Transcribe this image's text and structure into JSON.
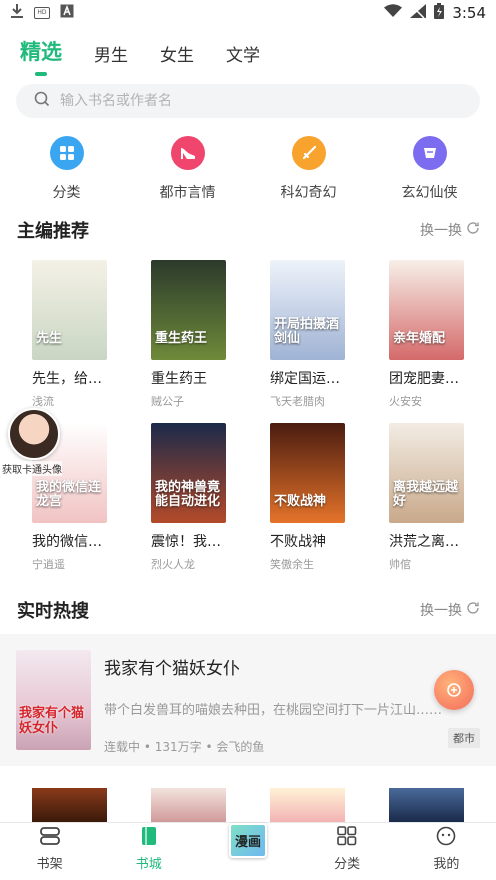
{
  "status_bar": {
    "time": "3:54",
    "left_icons": [
      "download-icon",
      "hd-icon",
      "a-icon"
    ],
    "right_icons": [
      "wifi-icon",
      "signal-icon",
      "battery-icon"
    ]
  },
  "top_tabs": [
    {
      "label": "精选",
      "active": true
    },
    {
      "label": "男生",
      "active": false
    },
    {
      "label": "女生",
      "active": false
    },
    {
      "label": "文学",
      "active": false
    }
  ],
  "search": {
    "placeholder": "输入书名或作者名"
  },
  "categories": [
    {
      "label": "分类",
      "icon": "grid-icon",
      "color": "#3aa6f2"
    },
    {
      "label": "都市言情",
      "icon": "heel-icon",
      "color": "#f0466e"
    },
    {
      "label": "科幻奇幻",
      "icon": "sword-icon",
      "color": "#f7a32e"
    },
    {
      "label": "玄幻仙侠",
      "icon": "scroll-icon",
      "color": "#7b6cf0"
    }
  ],
  "editor_picks": {
    "title": "主编推荐",
    "refresh_label": "换一换",
    "books": [
      {
        "title": "先生，给…",
        "author": "浅流",
        "cover_colors": [
          "#f4f1e6",
          "#c9d6c3"
        ],
        "cover_text": "先生"
      },
      {
        "title": "重生药王",
        "author": "贼公子",
        "cover_colors": [
          "#2b3a2b",
          "#6f8a3a"
        ],
        "cover_text": "重生药王"
      },
      {
        "title": "绑定国运…",
        "author": "飞天老腊肉",
        "cover_colors": [
          "#eef3fa",
          "#9fb3d4"
        ],
        "cover_text": "开局拍摄酒剑仙"
      },
      {
        "title": "团宠肥妻…",
        "author": "火安安",
        "cover_colors": [
          "#f7efe8",
          "#d46a6a"
        ],
        "cover_text": "亲年婚配"
      },
      {
        "title": "我的微信…",
        "author": "宁逍遥",
        "cover_colors": [
          "#ffffff",
          "#f1c3c3"
        ],
        "cover_text": "我的微信连龙宫"
      },
      {
        "title": "震惊！我…",
        "author": "烈火人龙",
        "cover_colors": [
          "#1b2a4a",
          "#b44a2a"
        ],
        "cover_text": "我的神兽竟能自动进化"
      },
      {
        "title": "不败战神",
        "author": "笑傲余生",
        "cover_colors": [
          "#4a1c10",
          "#e5732a"
        ],
        "cover_text": "不败战神"
      },
      {
        "title": "洪荒之离…",
        "author": "帅倌",
        "cover_colors": [
          "#f2ece4",
          "#c9a98a"
        ],
        "cover_text": "离我越远越好"
      }
    ]
  },
  "hot_search": {
    "title": "实时热搜",
    "refresh_label": "换一换",
    "book": {
      "title": "我家有个猫妖女仆",
      "description": "带个白发兽耳的喵娘去种田，在桃园空间打下一片江山……",
      "status": "连载中",
      "words": "131万字",
      "author": "会飞的鱼",
      "meta_separator": "•",
      "tag": "都市",
      "cover_text": "我家有个猫妖女仆"
    }
  },
  "floating": {
    "avatar_caption": "获取卡通头像"
  },
  "bottom_nav": [
    {
      "label": "书架",
      "icon": "bookshelf-icon",
      "active": false
    },
    {
      "label": "书城",
      "icon": "bookstore-icon",
      "active": true
    },
    {
      "label": "漫画",
      "icon": "manga-icon",
      "active": false,
      "special": true
    },
    {
      "label": "分类",
      "icon": "category-icon",
      "active": false
    },
    {
      "label": "我的",
      "icon": "profile-icon",
      "active": false
    }
  ]
}
